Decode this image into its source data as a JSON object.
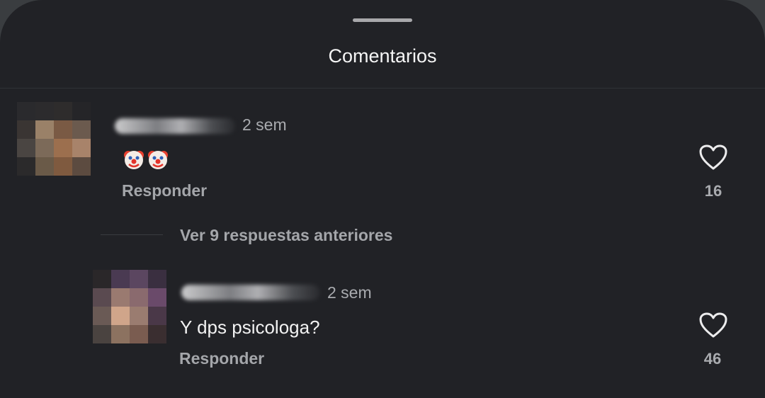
{
  "header": {
    "title": "Comentarios"
  },
  "comments": [
    {
      "time": "2 sem",
      "text": "🤡🤡",
      "reply_label": "Responder",
      "likes": "16",
      "like_icon": "heart-outline-icon"
    },
    {
      "time": "2 sem",
      "text": "Y dps psicologa?",
      "reply_label": "Responder",
      "likes": "46",
      "like_icon": "heart-outline-icon"
    }
  ],
  "thread": {
    "view_replies_label": "Ver 9 respuestas anteriores"
  },
  "colors": {
    "background": "#212226",
    "text_primary": "#f2f2f2",
    "text_secondary": "#a4a6aa"
  }
}
